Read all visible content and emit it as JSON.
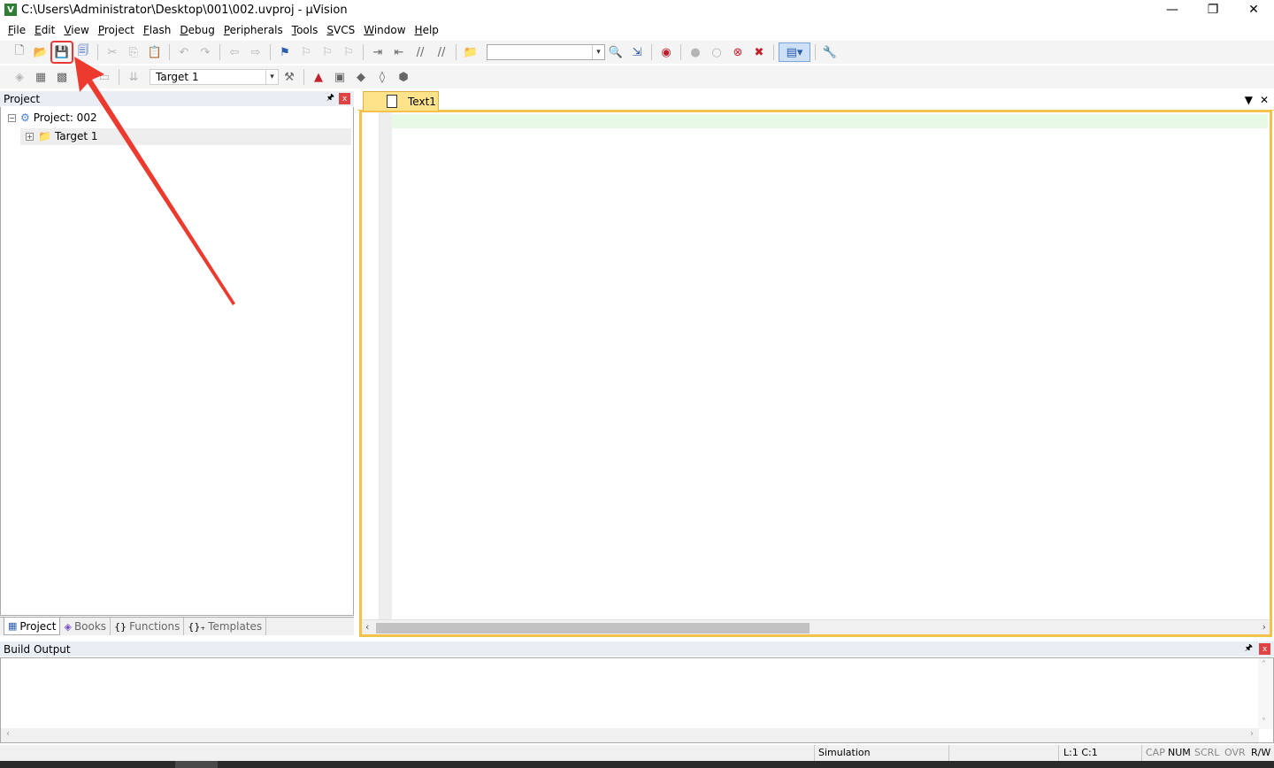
{
  "window": {
    "title": "C:\\Users\\Administrator\\Desktop\\001\\002.uvproj - µVision",
    "app_icon": "V",
    "minimize_glyph": "—",
    "restore_glyph": "❐",
    "close_glyph": "✕"
  },
  "menu": [
    {
      "u": "F",
      "rest": "ile"
    },
    {
      "u": "E",
      "rest": "dit"
    },
    {
      "u": "V",
      "rest": "iew"
    },
    {
      "u": "P",
      "rest": "roject"
    },
    {
      "u": "F",
      "rest": "lash"
    },
    {
      "u": "D",
      "rest": "ebug"
    },
    {
      "u": "P",
      "rest": "eripherals"
    },
    {
      "u": "T",
      "rest": "ools"
    },
    {
      "u": "S",
      "rest": "VCS"
    },
    {
      "u": "W",
      "rest": "indow"
    },
    {
      "u": "H",
      "rest": "elp"
    }
  ],
  "toolbar": {
    "target_value": "Target 1",
    "combo_drop": "▾"
  },
  "project_panel": {
    "header": "Project",
    "pin": "🖈",
    "close": "x",
    "root_label": "Project: 002",
    "target_label": "Target 1",
    "toggle_collapse": "−",
    "toggle_expand": "+",
    "tabs": [
      {
        "icon": "▦",
        "label": "Project"
      },
      {
        "icon": "◈",
        "label": "Books"
      },
      {
        "icon": "{}",
        "label": "Functions"
      },
      {
        "icon": "{}₊",
        "label": "Templates"
      }
    ]
  },
  "editor": {
    "tab_label": "Text1",
    "dropdown_glyph": "▼",
    "close_glyph": "✕",
    "scroll_left": "‹",
    "scroll_right": "›"
  },
  "build_output": {
    "header": "Build Output",
    "pin": "🖈",
    "close": "x"
  },
  "status": {
    "mode": "Simulation",
    "position": "L:1 C:1",
    "caps": "CAP",
    "num": "NUM",
    "scrl": "SCRL",
    "ovr": "OVR",
    "rw": "R/W"
  },
  "colors": {
    "annotation": "#ec3a2f",
    "tab_active": "#ffe38a",
    "editor_border": "#f3c24b",
    "current_line": "#e6fae6"
  }
}
